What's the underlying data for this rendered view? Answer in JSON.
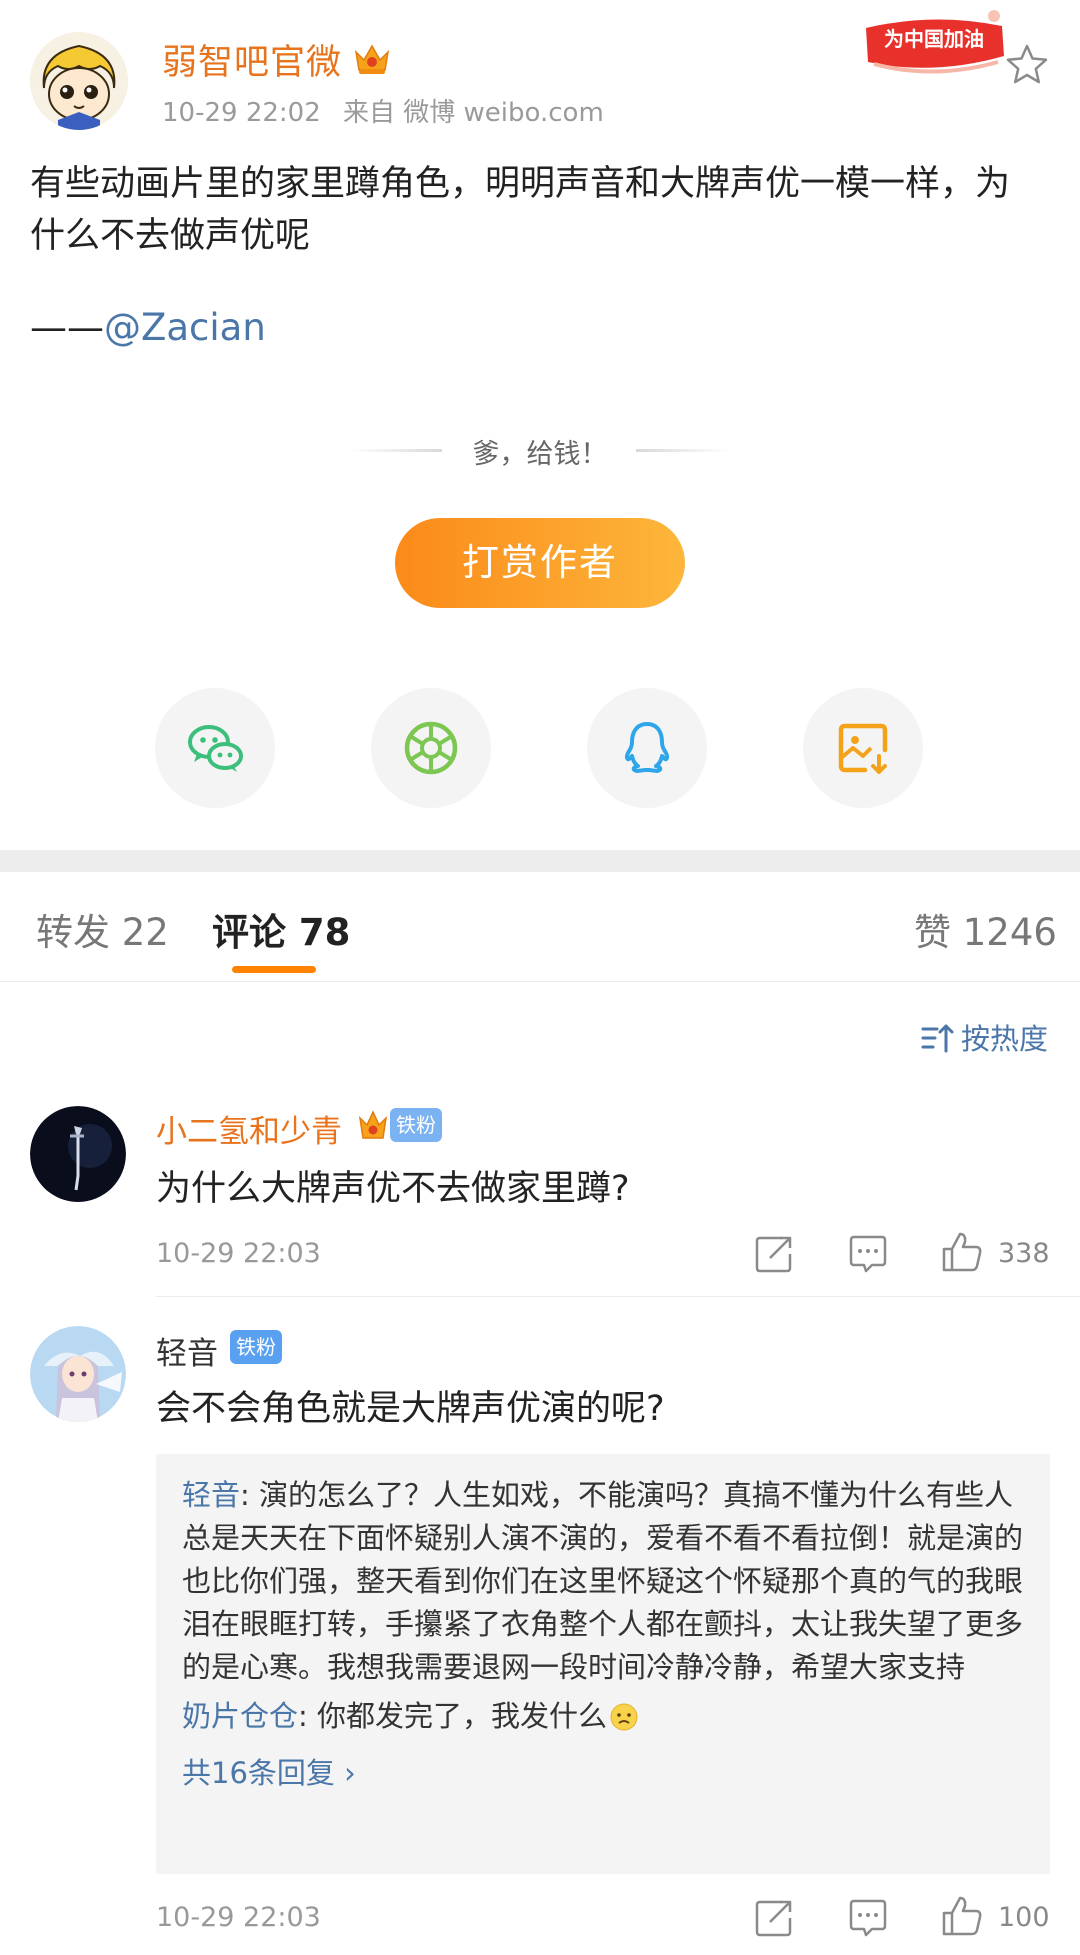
{
  "post": {
    "author": "弱智吧官微",
    "time": "10-29 22:02",
    "source": "来自 微博 weibo.com",
    "festival_badge": "为中国加油",
    "content": "有些动画片里的家里蹲角色，明明声音和大牌声优一模一样，为什么不去做声优呢",
    "credit_prefix": "——",
    "credit_mention": "@Zacian"
  },
  "reward": {
    "prompt": "爹，给钱！",
    "button": "打赏作者"
  },
  "share": {
    "items": [
      "wechat-icon",
      "moments-icon",
      "qq-icon",
      "save-image-icon"
    ]
  },
  "tabs": {
    "repost": "转发 22",
    "comments": "评论 78",
    "likes": "赞 1246"
  },
  "sort": {
    "label": "按热度"
  },
  "comments": [
    {
      "user": "小二氢和少青",
      "badge": "铁粉",
      "text": "为什么大牌声优不去做家里蹲?",
      "time": "10-29 22:03",
      "likes": "338"
    },
    {
      "user": "轻音",
      "badge": "铁粉",
      "text": "会不会角色就是大牌声优演的呢?",
      "time": "10-29 22:03",
      "likes": "100",
      "replies": [
        {
          "user": "轻音",
          "text": ": 演的怎么了？人生如戏，不能演吗？真搞不懂为什么有些人总是天天在下面怀疑别人演不演的，爱看不看不看拉倒！就是演的也比你们强，整天看到你们在这里怀疑这个怀疑那个真的气的我眼泪在眼眶打转，手攥紧了衣角整个人都在颤抖，太让我失望了更多的是心寒。我想我需要退网一段时间冷静冷静，希望大家支持"
        },
        {
          "user": "奶片仓仓",
          "text": ": 你都发完了，我发什么"
        }
      ],
      "more_replies": "共16条回复 ›"
    }
  ],
  "colors": {
    "accent": "#ff8200",
    "link": "#4a76a8",
    "username_vip": "#e8731d",
    "badge_blue": "#5aa0f0"
  }
}
